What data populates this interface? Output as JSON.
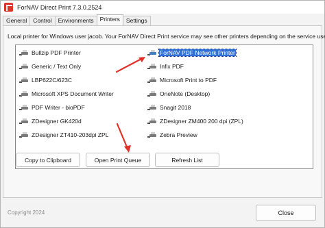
{
  "window": {
    "title": "ForNAV Direct Print 7.3.0.2524"
  },
  "tabs": [
    {
      "label": "General"
    },
    {
      "label": "Control"
    },
    {
      "label": "Environments"
    },
    {
      "label": "Printers",
      "active": true
    },
    {
      "label": "Settings"
    }
  ],
  "printers_panel": {
    "info": "Local printer for Windows user jacob. Your ForNAV Direct Print service may see other printers depending on the service user.",
    "printers": [
      {
        "label": "Bullzip PDF Printer",
        "icon": "printer-icon"
      },
      {
        "label": "ForNAV PDF Network Printer",
        "icon": "network-printer-icon",
        "selected": true
      },
      {
        "label": "Generic / Text Only",
        "icon": "printer-icon"
      },
      {
        "label": "Infix PDF",
        "icon": "printer-icon"
      },
      {
        "label": "LBP622C/623C",
        "icon": "printer-icon"
      },
      {
        "label": "Microsoft Print to PDF",
        "icon": "printer-icon"
      },
      {
        "label": "Microsoft XPS Document Writer",
        "icon": "printer-icon"
      },
      {
        "label": "OneNote (Desktop)",
        "icon": "printer-icon"
      },
      {
        "label": "PDF Writer - bioPDF",
        "icon": "printer-icon"
      },
      {
        "label": "Snagit 2018",
        "icon": "printer-icon"
      },
      {
        "label": "ZDesigner GK420d",
        "icon": "printer-icon"
      },
      {
        "label": "ZDesigner ZM400 200 dpi (ZPL)",
        "icon": "printer-icon"
      },
      {
        "label": "ZDesigner ZT410-203dpi ZPL",
        "icon": "printer-icon"
      },
      {
        "label": "Zebra Preview",
        "icon": "printer-icon"
      }
    ],
    "buttons": {
      "copy": "Copy to Clipboard",
      "open_queue": "Open Print Queue",
      "refresh": "Refresh List"
    }
  },
  "footer": {
    "copyright": "Copyright 2024",
    "close": "Close"
  },
  "colors": {
    "selection": "#2f6fd6",
    "annotation_arrow": "#e0322a",
    "app_icon": "#d9352a"
  }
}
